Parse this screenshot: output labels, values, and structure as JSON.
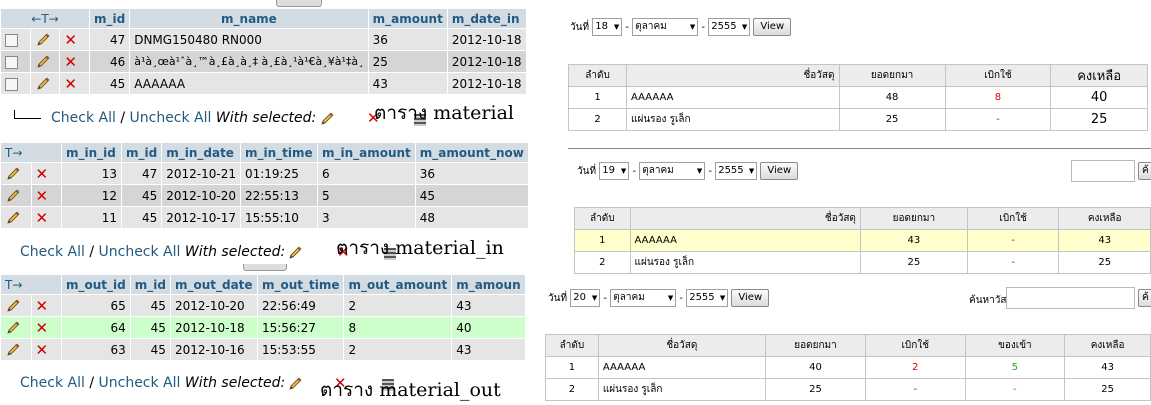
{
  "material": {
    "headers": [
      "m_id",
      "m_name",
      "m_amount",
      "m_date_in"
    ],
    "arrow_label": "←T→",
    "rows": [
      {
        "m_id": "47",
        "m_name": "DNMG150480 RN000",
        "m_amount": "36",
        "m_date_in": "2012-10-18"
      },
      {
        "m_id": "46",
        "m_name": "à¹à¸œà¹ˆà¸™à¸£à¸­à¸‡ à¸£à¸¹à¹€à¸¥à¹‡à¸",
        "m_amount": "25",
        "m_date_in": "2012-10-18"
      },
      {
        "m_id": "45",
        "m_name": "AAAAAA",
        "m_amount": "43",
        "m_date_in": "2012-10-18"
      }
    ],
    "footer": {
      "check_all": "Check All",
      "sep": "/",
      "uncheck_all": "Uncheck All",
      "with_selected": "With selected:"
    },
    "caption": "ตาราง material"
  },
  "material_in": {
    "arrow_label": "T→",
    "headers": [
      "m_in_id",
      "m_id",
      "m_in_date",
      "m_in_time",
      "m_in_amount",
      "m_amount_now"
    ],
    "rows": [
      {
        "m_in_id": "13",
        "m_id": "47",
        "m_in_date": "2012-10-21",
        "m_in_time": "01:19:25",
        "m_in_amount": "6",
        "m_amount_now": "36"
      },
      {
        "m_in_id": "12",
        "m_id": "45",
        "m_in_date": "2012-10-20",
        "m_in_time": "22:55:13",
        "m_in_amount": "5",
        "m_amount_now": "45"
      },
      {
        "m_in_id": "11",
        "m_id": "45",
        "m_in_date": "2012-10-17",
        "m_in_time": "15:55:10",
        "m_in_amount": "3",
        "m_amount_now": "48"
      }
    ],
    "footer": {
      "check_all": "Check All",
      "sep": "/",
      "uncheck_all": "Uncheck All",
      "with_selected": "With selected:"
    },
    "caption": "ตาราง material_in"
  },
  "material_out": {
    "arrow_label": "T→",
    "headers": [
      "m_out_id",
      "m_id",
      "m_out_date",
      "m_out_time",
      "m_out_amount",
      "m_amoun"
    ],
    "rows": [
      {
        "m_out_id": "65",
        "m_id": "45",
        "m_out_date": "2012-10-20",
        "m_out_time": "22:56:49",
        "m_out_amount": "2",
        "m_amoun": "43"
      },
      {
        "m_out_id": "64",
        "m_id": "45",
        "m_out_date": "2012-10-18",
        "m_out_time": "15:56:27",
        "m_out_amount": "8",
        "m_amoun": "40"
      },
      {
        "m_out_id": "63",
        "m_id": "45",
        "m_out_date": "2012-10-16",
        "m_out_time": "15:53:55",
        "m_out_amount": "2",
        "m_amoun": "43"
      }
    ],
    "footer": {
      "check_all": "Check All",
      "sep": "/",
      "uncheck_all": "Uncheck All",
      "with_selected": "With selected:"
    },
    "caption": "ตาราง material_out"
  },
  "report1": {
    "filter": {
      "date_label": "วันที่",
      "day": "18",
      "sep": "-",
      "month": "ตุลาคม",
      "year": "2555",
      "view": "View"
    },
    "headers": [
      "ลำดับ",
      "ชื่อวัสดุ",
      "ยอดยกมา",
      "เบิกใช้",
      "คงเหลือ"
    ],
    "rows": [
      {
        "no": "1",
        "name": "AAAAAA",
        "carry": "48",
        "used": "8",
        "remain": "40"
      },
      {
        "no": "2",
        "name": "แผ่นรอง รูเล็ก",
        "carry": "25",
        "used": "-",
        "remain": "25"
      }
    ]
  },
  "report2": {
    "filter": {
      "date_label": "วันที่",
      "day": "19",
      "sep": "-",
      "month": "ตุลาคม",
      "year": "2555",
      "view": "View",
      "btn_partial": "ค้"
    },
    "headers": [
      "ลำดับ",
      "ชื่อวัสดุ",
      "ยอดยกมา",
      "เบิกใช้",
      "คงเหลือ"
    ],
    "rows": [
      {
        "no": "1",
        "name": "AAAAAA",
        "carry": "43",
        "used": "-",
        "remain": "43"
      },
      {
        "no": "2",
        "name": "แผ่นรอง รูเล็ก",
        "carry": "25",
        "used": "-",
        "remain": "25"
      }
    ]
  },
  "report3": {
    "filter": {
      "date_label": "วันที่",
      "day": "20",
      "sep": "-",
      "month": "ตุลาคม",
      "year": "2555",
      "view": "View",
      "search_label": "ค้นหาวัสดุ",
      "btn_partial": "ค้"
    },
    "headers": [
      "ลำดับ",
      "ชื่อวัสดุ",
      "ยอดยกมา",
      "เบิกใช้",
      "ของเข้า",
      "คงเหลือ"
    ],
    "rows": [
      {
        "no": "1",
        "name": "AAAAAA",
        "carry": "40",
        "used": "2",
        "in": "5",
        "remain": "43"
      },
      {
        "no": "2",
        "name": "แผ่นรอง รูเล็ก",
        "carry": "25",
        "used": "-",
        "in": "-",
        "remain": "25"
      }
    ]
  }
}
